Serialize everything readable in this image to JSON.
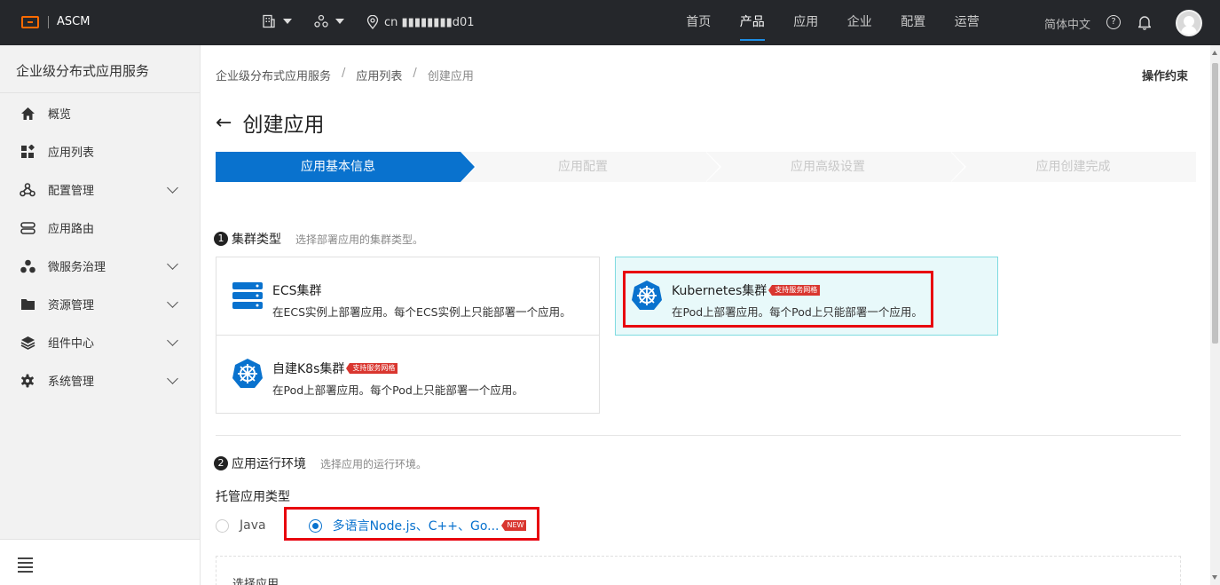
{
  "topbar": {
    "logo_text": "ASCM",
    "region_text": "cn ▮▮▮▮▮▮▮▮d01",
    "nav": [
      {
        "label": "首页",
        "active": false
      },
      {
        "label": "产品",
        "active": true
      },
      {
        "label": "应用",
        "active": false
      },
      {
        "label": "企业",
        "active": false
      },
      {
        "label": "配置",
        "active": false
      },
      {
        "label": "运营",
        "active": false
      }
    ],
    "language": "简体中文",
    "help_symbol": "?",
    "accent_color": "#ff6a00"
  },
  "sidebar": {
    "title": "企业级分布式应用服务",
    "items": [
      {
        "label": "概览",
        "icon": "home-icon"
      },
      {
        "label": "应用列表",
        "icon": "apps-grid-icon"
      },
      {
        "label": "配置管理",
        "icon": "config-nodes-icon",
        "expandable": true
      },
      {
        "label": "应用路由",
        "icon": "route-icon"
      },
      {
        "label": "微服务治理",
        "icon": "microservice-icon",
        "expandable": true
      },
      {
        "label": "资源管理",
        "icon": "folder-icon",
        "expandable": true
      },
      {
        "label": "组件中心",
        "icon": "layers-icon",
        "expandable": true
      },
      {
        "label": "系统管理",
        "icon": "gear-icon",
        "expandable": true
      }
    ]
  },
  "breadcrumb": {
    "items": [
      "企业级分布式应用服务",
      "应用列表",
      "创建应用"
    ],
    "separator": "/"
  },
  "header": {
    "op_link": "操作约束",
    "back_arrow": "←",
    "title": "创建应用"
  },
  "steps": [
    {
      "label": "应用基本信息",
      "active": true
    },
    {
      "label": "应用配置",
      "active": false
    },
    {
      "label": "应用高级设置",
      "active": false
    },
    {
      "label": "应用创建完成",
      "active": false
    }
  ],
  "section1": {
    "num": "1",
    "title": "集群类型",
    "subtitle": "选择部署应用的集群类型。",
    "cards": [
      {
        "title": "ECS集群",
        "desc": "在ECS实例上部署应用。每个ECS实例上只能部署一个应用。",
        "tag": ""
      },
      {
        "title": "Kubernetes集群",
        "desc": "在Pod上部署应用。每个Pod上只能部署一个应用。",
        "tag": "支持服务网格",
        "selected": true
      },
      {
        "title": "自建K8s集群",
        "desc": "在Pod上部署应用。每个Pod上只能部署一个应用。",
        "tag": "支持服务网格"
      }
    ]
  },
  "section2": {
    "num": "2",
    "title": "应用运行环境",
    "subtitle": "选择应用的运行环境。",
    "hosted_label": "托管应用类型",
    "options": [
      {
        "label": "Java",
        "selected": false
      },
      {
        "label": "多语言Node.js、C++、Go...",
        "selected": true,
        "tag": "NEW"
      }
    ],
    "select_app_label": "选择应用"
  },
  "colors": {
    "primary": "#0972ce",
    "highlight_box": "#e8000e",
    "selected_card_bg": "#e8f9fa"
  }
}
